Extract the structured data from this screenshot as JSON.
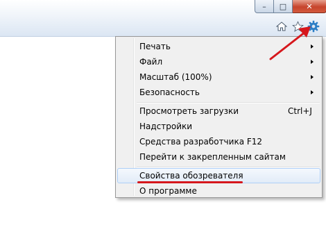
{
  "window": {
    "buttons": {
      "minimize_glyph": "–",
      "maximize_glyph": "□",
      "close_glyph": "✕"
    },
    "toolbar_icons": [
      "home-icon",
      "star-icon",
      "gear-icon"
    ]
  },
  "menu": {
    "items": [
      {
        "label": "Печать",
        "submenu": true
      },
      {
        "label": "Файл",
        "submenu": true
      },
      {
        "label": "Масштаб (100%)",
        "submenu": true
      },
      {
        "label": "Безопасность",
        "submenu": true
      },
      {
        "label": "Просмотреть загрузки",
        "shortcut": "Ctrl+J"
      },
      {
        "label": "Надстройки"
      },
      {
        "label": "Средства разработчика F12"
      },
      {
        "label": "Перейти к закрепленным сайтам"
      },
      {
        "label": "Свойства обозревателя",
        "highlighted": true
      },
      {
        "label": "О программе"
      }
    ]
  },
  "colors": {
    "annotation_red": "#d6171c",
    "gear_blue": "#2d7fc6",
    "highlight_border": "#aecff7"
  }
}
